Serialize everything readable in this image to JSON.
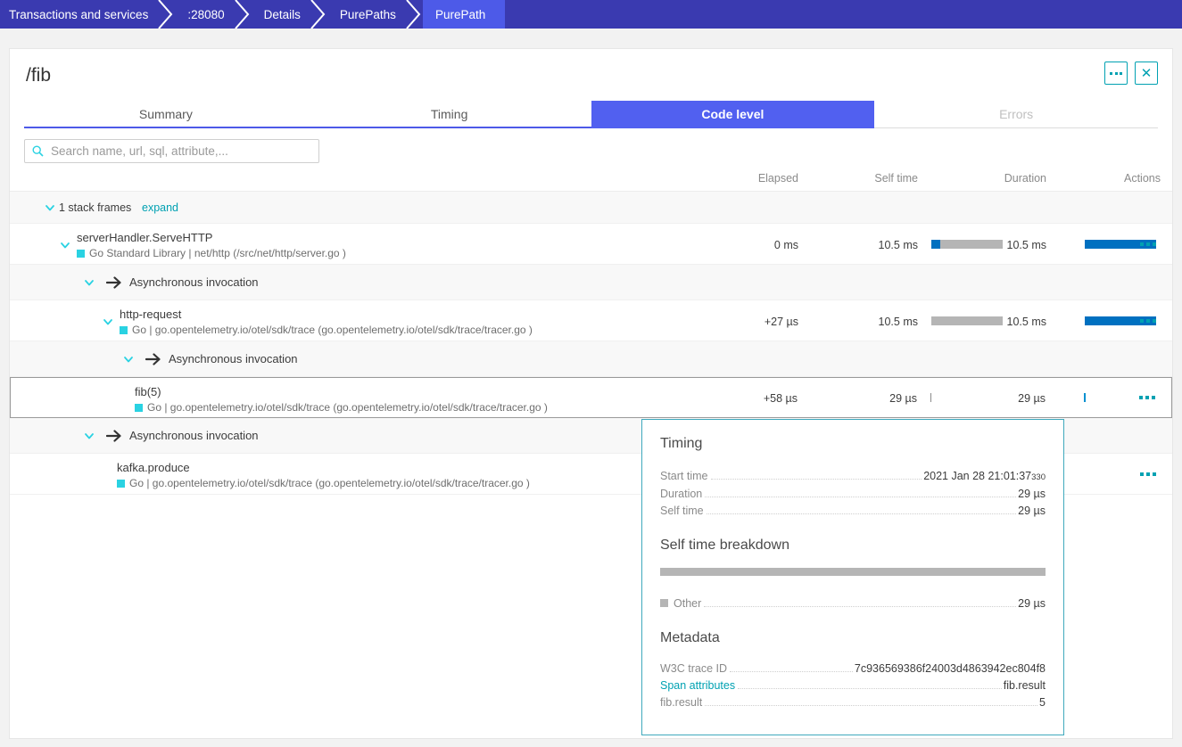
{
  "breadcrumb": {
    "items": [
      {
        "label": "Transactions and services",
        "active": false
      },
      {
        "label": ":28080",
        "active": false
      },
      {
        "label": "Details",
        "active": false
      },
      {
        "label": "PurePaths",
        "active": false
      },
      {
        "label": "PurePath",
        "active": true
      }
    ]
  },
  "card": {
    "title": "/fib",
    "head_actions": {
      "more_label": "more-options",
      "close_label": "close"
    },
    "tabs": [
      {
        "label": "Summary",
        "state": "normal"
      },
      {
        "label": "Timing",
        "state": "normal"
      },
      {
        "label": "Code level",
        "state": "active"
      },
      {
        "label": "Errors",
        "state": "disabled"
      }
    ],
    "search": {
      "placeholder": "Search name, url, sql, attribute,...",
      "value": "",
      "icon": "search-icon"
    },
    "columns": {
      "elapsed": "Elapsed",
      "self_time": "Self time",
      "duration": "Duration",
      "actions": "Actions"
    },
    "stack_frames": {
      "count_label": "1 stack frames",
      "expand_label": "expand"
    },
    "rows": [
      {
        "kind": "frame",
        "name": "serverHandler.ServeHTTP",
        "detail": "Go Standard Library | net/http (/src/net/http/server.go )",
        "elapsed": "0 ms",
        "self_time": "10.5 ms",
        "duration": "10.5 ms",
        "self_bar_blue_pct": 12,
        "duration_bar_pct": 100
      },
      {
        "kind": "async",
        "name": "Asynchronous invocation"
      },
      {
        "kind": "frame",
        "name": "http-request",
        "detail": "Go | go.opentelemetry.io/otel/sdk/trace (go.opentelemetry.io/otel/sdk/trace/tracer.go )",
        "elapsed": "+27 µs",
        "self_time": "10.5 ms",
        "duration": "10.5 ms",
        "self_bar_blue_pct": 0,
        "duration_bar_pct": 100
      },
      {
        "kind": "async",
        "name": "Asynchronous invocation"
      },
      {
        "kind": "frame",
        "name": "fib(5)",
        "detail": "Go | go.opentelemetry.io/otel/sdk/trace (go.opentelemetry.io/otel/sdk/trace/tracer.go )",
        "elapsed": "+58 µs",
        "self_time": "29 µs",
        "duration": "29 µs",
        "selected": true
      },
      {
        "kind": "async",
        "name": "Asynchronous invocation"
      },
      {
        "kind": "frame",
        "name": "kafka.produce",
        "detail": "Go | go.opentelemetry.io/otel/sdk/trace (go.opentelemetry.io/otel/sdk/trace/tracer.go )",
        "elapsed": "",
        "self_time": "",
        "duration": ""
      }
    ]
  },
  "tooltip": {
    "timing_heading": "Timing",
    "timing_rows": [
      {
        "key": "Start time",
        "value": "2021 Jan 28 21:01:37",
        "value_sub": "330"
      },
      {
        "key": "Duration",
        "value": "29 µs",
        "value_sub": ""
      },
      {
        "key": "Self time",
        "value": "29 µs",
        "value_sub": ""
      }
    ],
    "breakdown_heading": "Self time breakdown",
    "breakdown_legend": [
      {
        "label": "Other",
        "value": "29 µs",
        "color": "#b5b5b5",
        "pct": 100
      }
    ],
    "metadata_heading": "Metadata",
    "metadata_rows": [
      {
        "key": "W3C trace ID",
        "value": "7c936569386f24003d4863942ec804f8",
        "link": false
      },
      {
        "key": "Span attributes",
        "value": "fib.result",
        "link": true
      },
      {
        "key": "fib.result",
        "value": "5",
        "link": false
      }
    ]
  },
  "colors": {
    "breadcrumb_bg": "#3a3ab0",
    "breadcrumb_active_bg": "#4d5ae8",
    "tab_active_bg": "#5160f0",
    "accent_teal": "#00a1b2",
    "lang_swatch": "#2ad2e2",
    "bar_blue": "#0070c0",
    "bar_gray": "#b5b5b5"
  }
}
